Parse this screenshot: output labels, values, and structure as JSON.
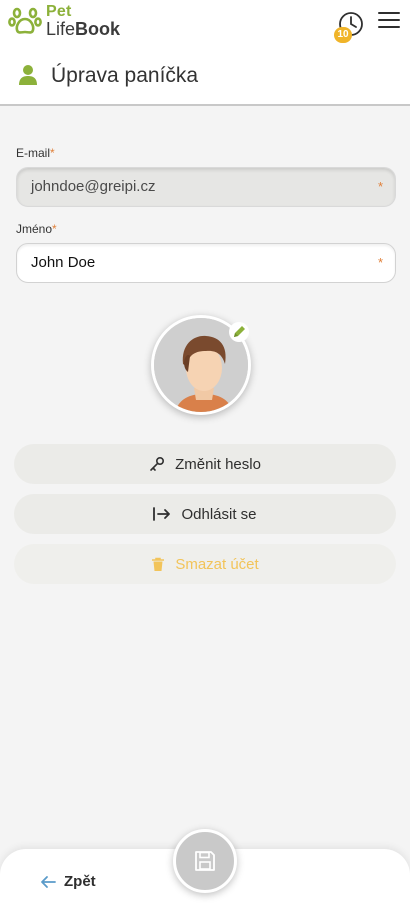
{
  "header": {
    "logo_pet": "Pet",
    "logo_life": "Life",
    "logo_book": "Book",
    "history_badge": "10"
  },
  "page": {
    "title": "Úprava paníčka"
  },
  "form": {
    "email_label": "E-mail",
    "email_required": "*",
    "email_value": "johndoe@greipi.cz",
    "name_label": "Jméno",
    "name_required": "*",
    "name_value": "John Doe"
  },
  "actions": {
    "change_password": "Změnit heslo",
    "logout": "Odhlásit se",
    "delete_account": "Smazat účet"
  },
  "footer": {
    "back_label": "Zpět"
  },
  "icons": {
    "logo": "paw-icon",
    "history": "clock-icon",
    "menu": "hamburger-icon",
    "page": "person-icon",
    "avatar_edit": "pencil-icon",
    "change_password": "key-icon",
    "logout": "logout-icon",
    "delete_account": "trash-icon",
    "back": "arrow-left-icon",
    "save": "floppy-disk-icon"
  },
  "colors": {
    "brand_green": "#8cb13a",
    "badge_yellow": "#f0b429",
    "required_orange": "#e0803a",
    "danger_text": "#f2c45a",
    "back_arrow": "#5a9bc9"
  }
}
